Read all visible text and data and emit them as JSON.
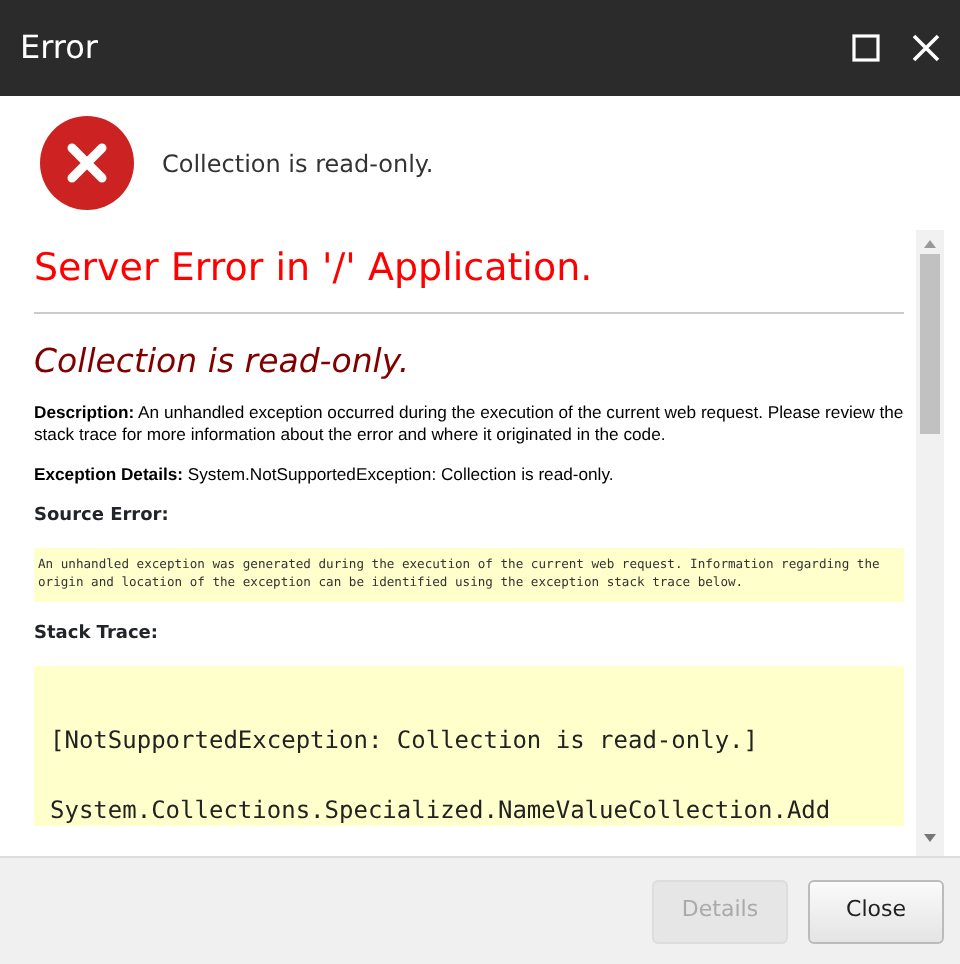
{
  "window": {
    "title": "Error"
  },
  "message": "Collection is read-only.",
  "error_page": {
    "heading": "Server Error in '/' Application.",
    "subheading": "Collection is read-only.",
    "sections": [
      {
        "kind": "paragraph",
        "text": "**Description:** An unhandled exception occurred during the execution of the current web request. Please review the stack trace for more information about the error and where it originated in the code."
      },
      {
        "kind": "paragraph",
        "text": "**Exception Details:** System.NotSupportedException: Collection is read-only."
      },
      {
        "kind": "label",
        "text": "Source Error:"
      },
      {
        "kind": "note",
        "lines": [
          "An unhandled exception was generated during the execution of the current web request. Information regarding the origin and location of the exception can be identified using the exception stack trace below."
        ]
      },
      {
        "kind": "label",
        "text": "Stack Trace:"
      },
      {
        "kind": "code",
        "lines": [
          "[NotSupportedException: Collection is read-only.]",
          "System.Collections.Specialized.NameValueCollection.Add"
        ]
      }
    ]
  },
  "buttons": [
    {
      "label": "Details",
      "disabled": true
    },
    {
      "label": "Close",
      "disabled": false
    }
  ]
}
